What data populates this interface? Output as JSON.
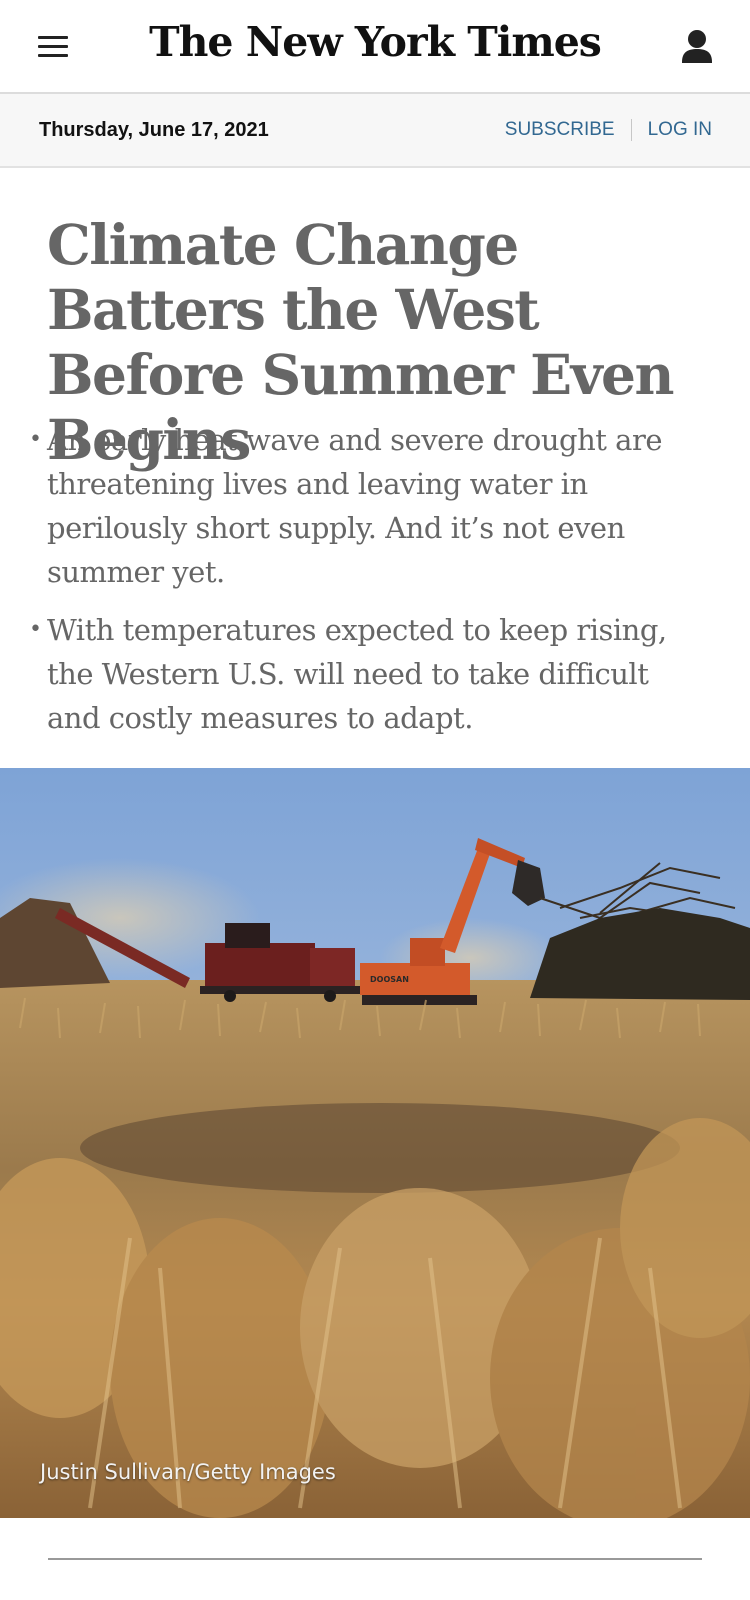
{
  "header": {
    "logo_text": "The New York Times",
    "menu_icon": "hamburger-menu-icon",
    "account_icon": "user-account-icon"
  },
  "dateline": {
    "date": "Thursday, June 17, 2021",
    "subscribe_label": "SUBSCRIBE",
    "login_label": "LOG IN",
    "link_color": "#326891"
  },
  "article": {
    "headline": "Climate Change Batters the West Before Summer Even Begins",
    "summary": [
      "An early heat wave and severe drought are threatening lives and leaving water in perilously short supply. And it’s not even summer yet.",
      "With temperatures expected to keep rising, the Western U.S. will need to take difficult and costly measures to adapt."
    ],
    "photo_credit": "Justin Sullivan/Getty Images",
    "machine_label": "DOOSAN"
  }
}
